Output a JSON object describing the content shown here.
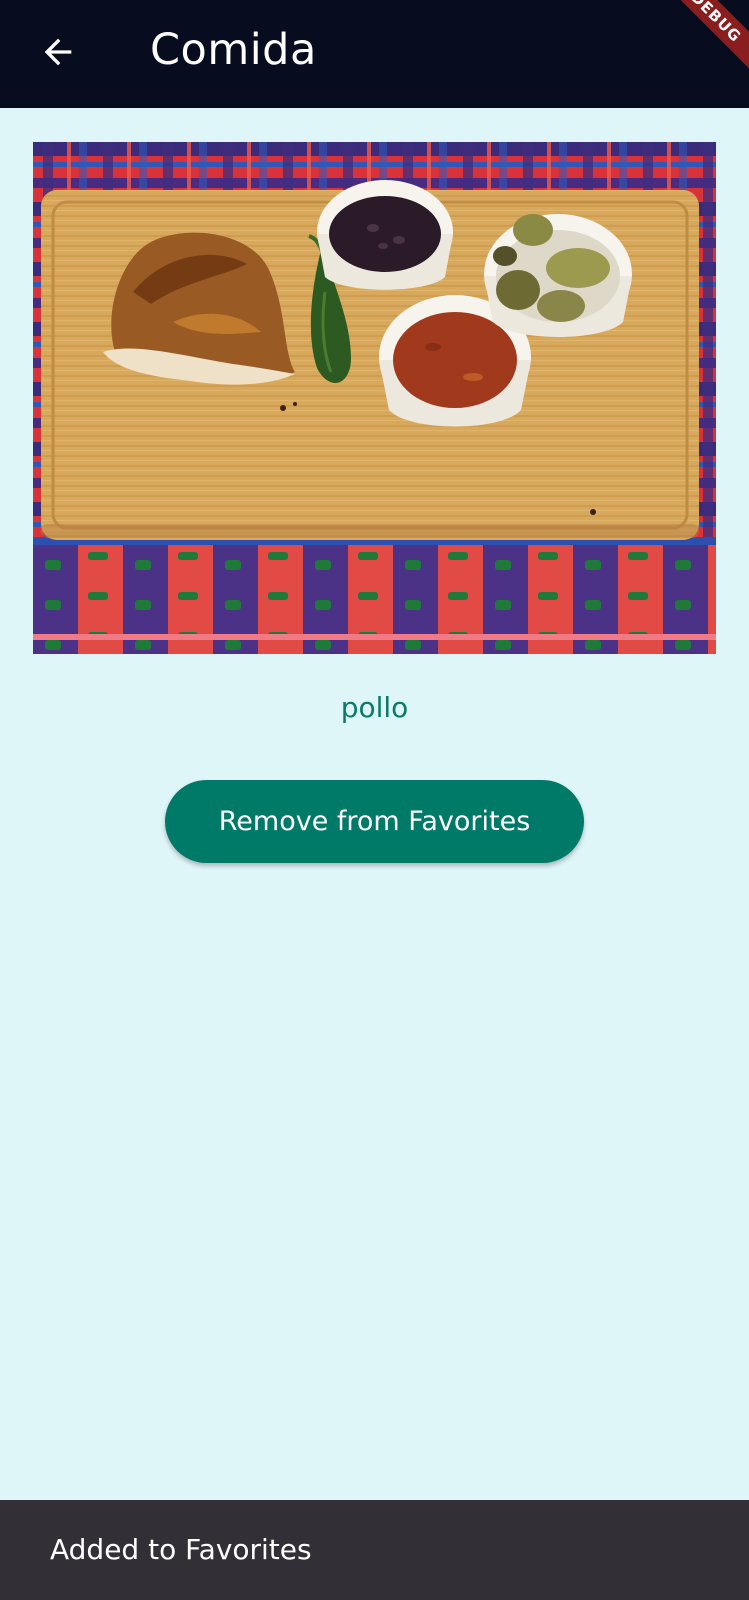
{
  "app_bar": {
    "title": "Comida",
    "back_icon": "arrow-left-icon",
    "debug_banner": "DEBUG"
  },
  "food": {
    "name": "pollo",
    "image_alt": "Plate with roasted chicken, jalapeño, black beans, salsa and potatoes on a wooden board"
  },
  "actions": {
    "remove_favorite_label": "Remove from Favorites"
  },
  "snackbar": {
    "message": "Added to Favorites"
  },
  "colors": {
    "app_bar": "#070c1f",
    "background": "#dff6f9",
    "accent": "#007a68",
    "snackbar": "#323036"
  }
}
